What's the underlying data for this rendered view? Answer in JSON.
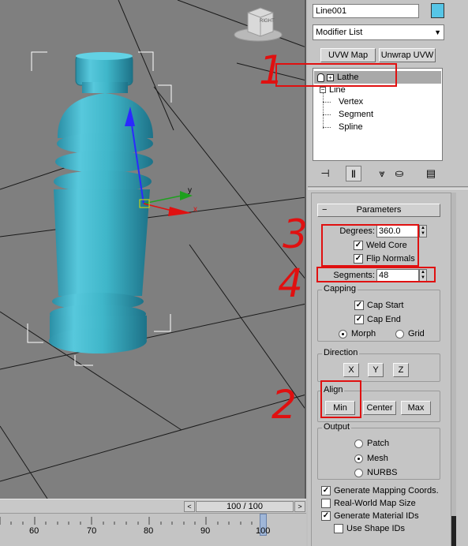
{
  "viewport": {
    "viewcube_label": "RIGHT",
    "axis_labels": {
      "x": "x",
      "y": "y",
      "z": ""
    },
    "colors": {
      "background": "#7f7f7f",
      "object": "#3fb6c9",
      "grid": "#000000"
    }
  },
  "timeline": {
    "slider_text": "100 / 100",
    "ticks": [
      "60",
      "70",
      "80",
      "90",
      "100"
    ],
    "prev_arrow": "<",
    "next_arrow": ">"
  },
  "panel": {
    "object_name": "Line001",
    "object_color": "#56c5e6",
    "modifier_list": "Modifier List",
    "buttons": {
      "uvw_map": "UVW Map",
      "unwrap_uvw": "Unwrap UVW"
    },
    "stack": [
      {
        "label": "Lathe",
        "level": 0,
        "selected": true
      },
      {
        "label": "Line",
        "level": 0
      },
      {
        "label": "Vertex",
        "level": 1
      },
      {
        "label": "Segment",
        "level": 1
      },
      {
        "label": "Spline",
        "level": 1
      }
    ],
    "rollout": {
      "minus": "−",
      "title": "Parameters",
      "degrees_label": "Degrees:",
      "degrees_value": "360.0",
      "weld_core": "Weld Core",
      "flip_normals": "Flip Normals",
      "segments_label": "Segments:",
      "segments_value": "48",
      "capping": {
        "title": "Capping",
        "cap_start": "Cap Start",
        "cap_end": "Cap End",
        "morph": "Morph",
        "grid": "Grid"
      },
      "direction": {
        "title": "Direction",
        "x": "X",
        "y": "Y",
        "z": "Z"
      },
      "align": {
        "title": "Align",
        "min": "Min",
        "center": "Center",
        "max": "Max"
      },
      "output": {
        "title": "Output",
        "patch": "Patch",
        "mesh": "Mesh",
        "nurbs": "NURBS"
      },
      "gen_mapping": "Generate Mapping Coords.",
      "real_world": "Real-World Map Size",
      "gen_material": "Generate Material IDs",
      "use_shape_ids": "Use Shape IDs"
    }
  },
  "annotations": {
    "one": "1",
    "two": "2",
    "three": "3",
    "four": "4",
    "color": "#e01010"
  }
}
